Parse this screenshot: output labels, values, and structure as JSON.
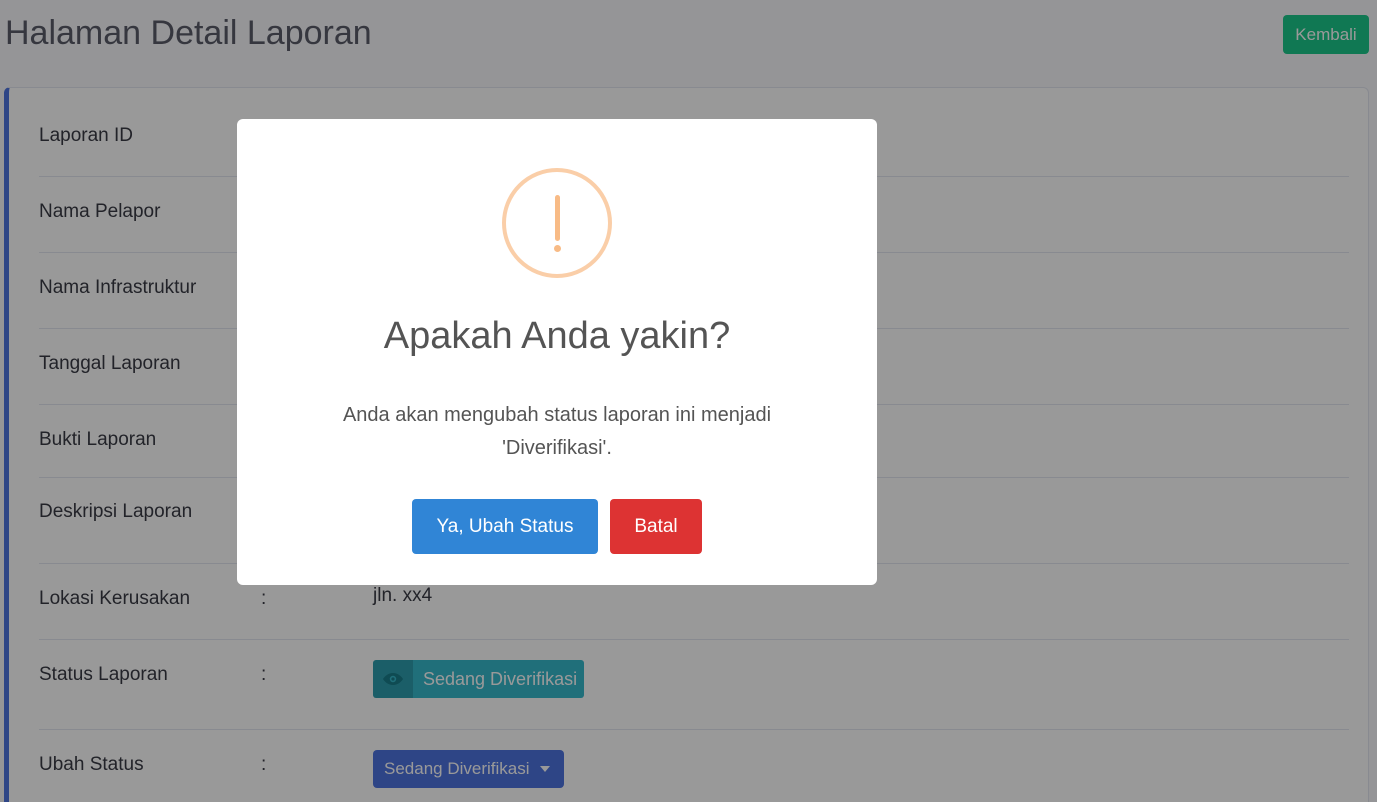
{
  "header": {
    "title": "Halaman Detail Laporan",
    "back_label": "Kembali"
  },
  "details": {
    "laporan_id": {
      "label": "Laporan ID"
    },
    "nama_pelapor": {
      "label": "Nama Pelapor"
    },
    "nama_infrastruktur": {
      "label": "Nama Infrastruktur"
    },
    "tanggal_laporan": {
      "label": "Tanggal Laporan"
    },
    "bukti_laporan": {
      "label": "Bukti Laporan"
    },
    "deskripsi_laporan": {
      "label": "Deskripsi Laporan"
    },
    "lokasi_kerusakan": {
      "label": "Lokasi Kerusakan",
      "colon": ":",
      "value": "jln. xx4"
    },
    "status_laporan": {
      "label": "Status Laporan",
      "colon": ":",
      "value": "Sedang Diverifikasi",
      "icon": "eye-icon",
      "color": "#36b9cc"
    },
    "ubah_status": {
      "label": "Ubah Status",
      "colon": ":",
      "value": "Sedang Diverifikasi",
      "color": "#4e73df"
    }
  },
  "modal": {
    "icon": "warning-icon",
    "title": "Apakah Anda yakin?",
    "text_line1": "Anda akan mengubah status laporan ini menjadi",
    "text_line2": "'Diverifikasi'.",
    "confirm_label": "Ya, Ubah Status",
    "cancel_label": "Batal",
    "confirm_color": "#3085d6",
    "cancel_color": "#dd3333"
  }
}
